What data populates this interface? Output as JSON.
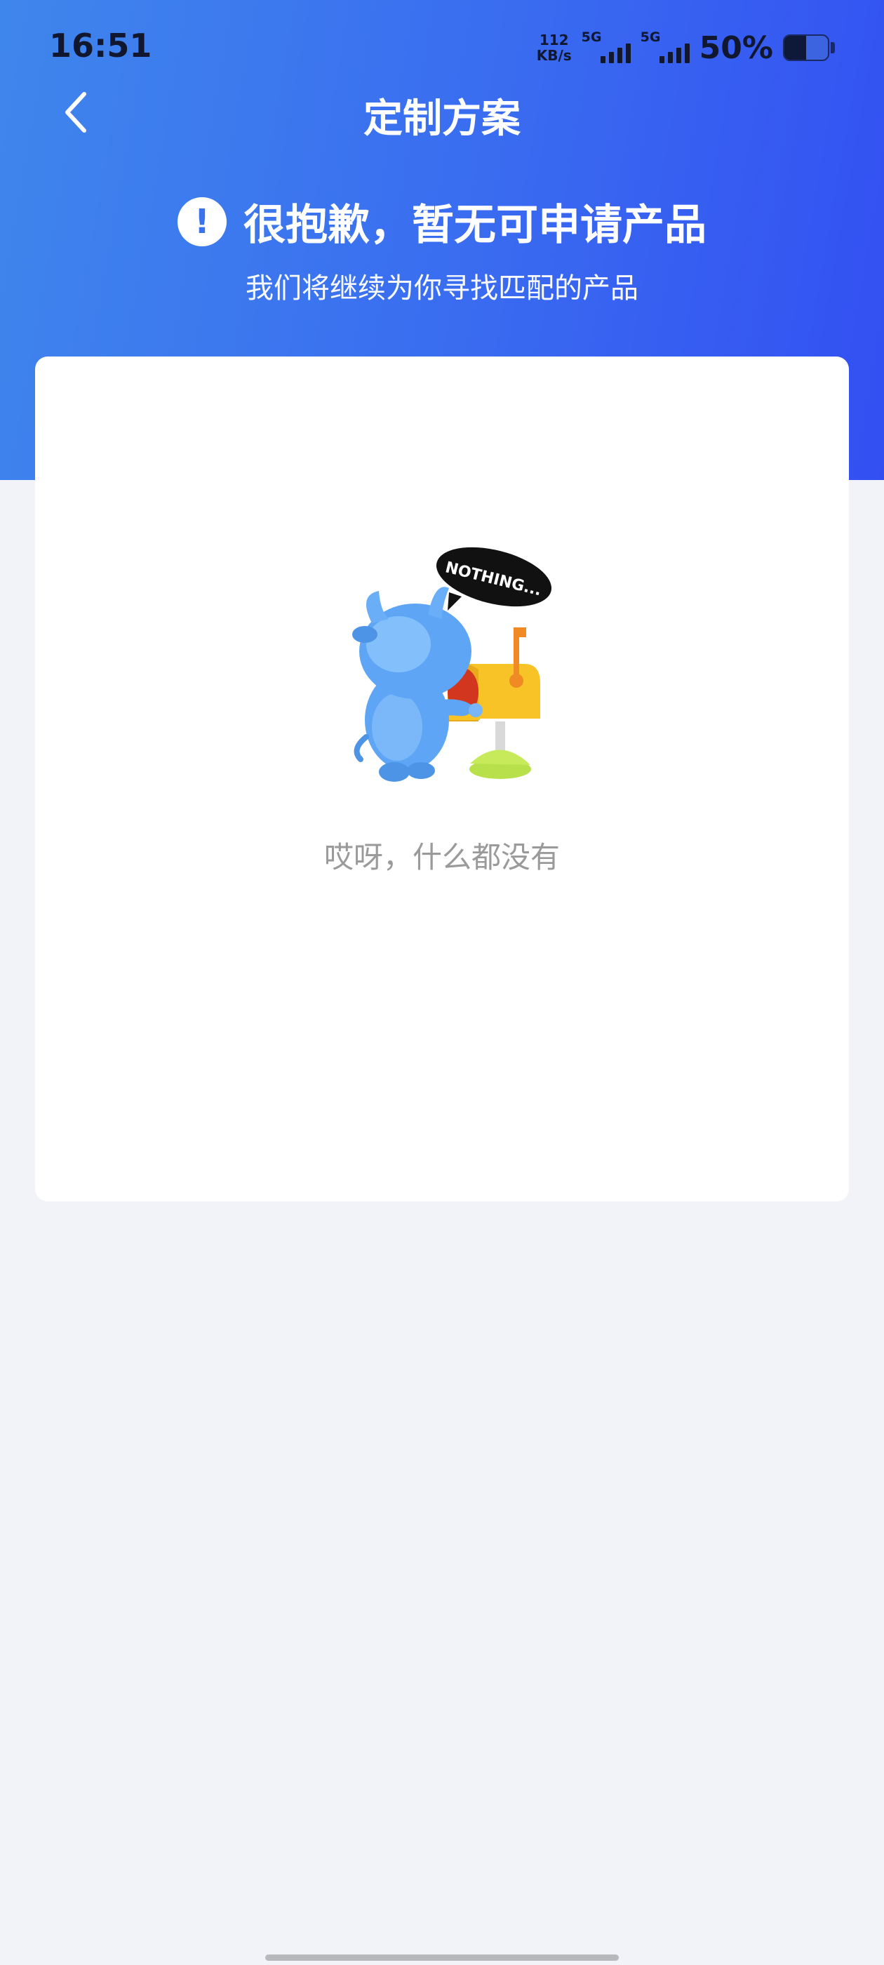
{
  "status_bar": {
    "time": "16:51",
    "net_speed_value": "112",
    "net_speed_unit": "KB/s",
    "sim1_label": "5G",
    "sim2_label": "5G",
    "battery_percent": "50%",
    "battery_level": 0.5
  },
  "nav": {
    "title": "定制方案",
    "back_icon": "chevron-left-icon"
  },
  "notice": {
    "icon": "exclamation-icon",
    "icon_glyph": "!",
    "title": "很抱歉，暂无可申请产品",
    "subtitle": "我们将继续为你寻找匹配的产品"
  },
  "empty_state": {
    "bubble_text": "NOTHING...",
    "message": "哎呀，什么都没有"
  },
  "colors": {
    "header_gradient_start": "#3f86ec",
    "header_gradient_end": "#334ff2",
    "page_background": "#f2f3f8",
    "empty_text": "#9a9a9a"
  }
}
